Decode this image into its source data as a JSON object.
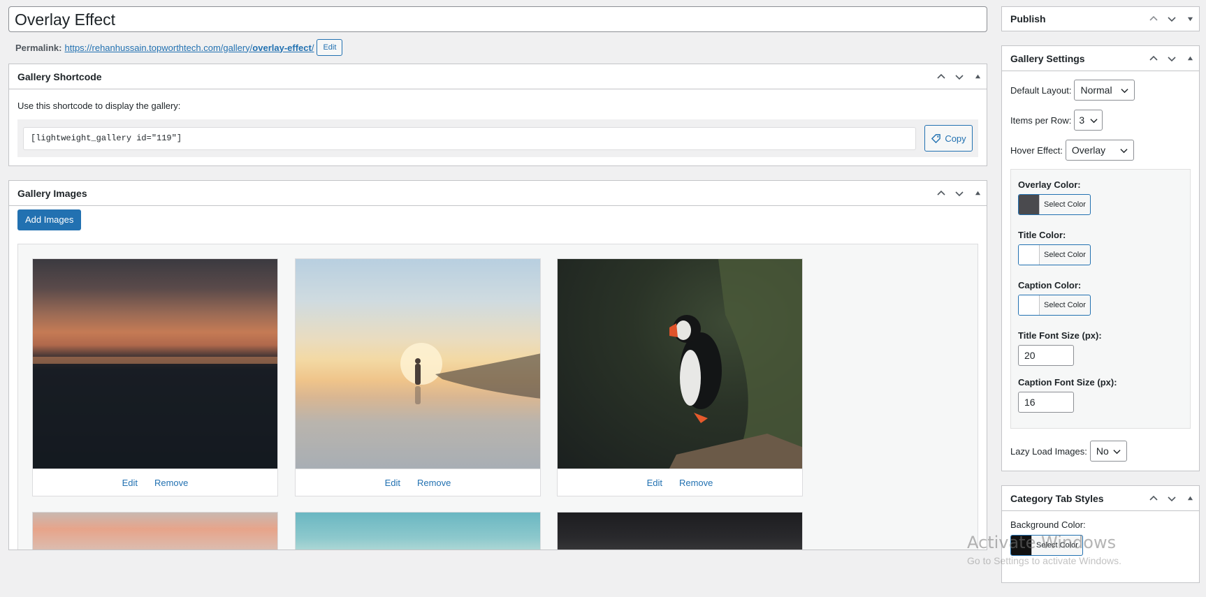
{
  "post": {
    "title": "Overlay Effect",
    "permalink_label": "Permalink:",
    "permalink_base": "https://rehanhussain.topworthtech.com/gallery/",
    "permalink_slug": "overlay-effect",
    "permalink_trail": "/",
    "permalink_edit": "Edit"
  },
  "shortcode_box": {
    "title": "Gallery Shortcode",
    "description": "Use this shortcode to display the gallery:",
    "shortcode": "[lightweight_gallery id=\"119\"]",
    "copy_label": "Copy"
  },
  "images_box": {
    "title": "Gallery Images",
    "add_label": "Add Images",
    "images": [
      {
        "edit": "Edit",
        "remove": "Remove",
        "subject": "sunset over sea"
      },
      {
        "edit": "Edit",
        "remove": "Remove",
        "subject": "person walking on beach at sunset"
      },
      {
        "edit": "Edit",
        "remove": "Remove",
        "subject": "puffin on rock"
      }
    ]
  },
  "publish_box": {
    "title": "Publish"
  },
  "gallery_settings": {
    "title": "Gallery Settings",
    "default_layout_label": "Default Layout:",
    "default_layout_value": "Normal",
    "items_per_row_label": "Items per Row:",
    "items_per_row_value": "3",
    "hover_effect_label": "Hover Effect:",
    "hover_effect_value": "Overlay",
    "overlay_color_label": "Overlay Color:",
    "title_color_label": "Title Color:",
    "caption_color_label": "Caption Color:",
    "select_color": "Select Color",
    "title_font_size_label": "Title Font Size (px):",
    "title_font_size_value": "20",
    "caption_font_size_label": "Caption Font Size (px):",
    "caption_font_size_value": "16",
    "lazy_load_label": "Lazy Load Images:",
    "lazy_load_value": "No",
    "overlay_color": "#4a4a4e",
    "title_color": "#ffffff",
    "caption_color": "#ffffff"
  },
  "category_tab_styles": {
    "title": "Category Tab Styles",
    "background_color_label": "Background Color:",
    "select_color": "Select Color",
    "background_color": "#111111"
  },
  "watermark": {
    "line1": "Activate Windows",
    "line2": "Go to Settings to activate Windows."
  },
  "colors": {
    "accent": "#2271b1",
    "border": "#c3c4c7",
    "background": "#f0f0f1"
  }
}
